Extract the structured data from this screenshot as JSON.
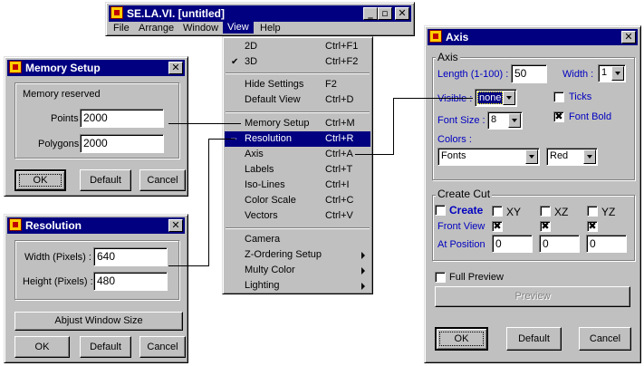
{
  "main_window": {
    "title": "SE.LA.VI. [untitled]",
    "controls": {
      "minimize": "_",
      "maximize": "▫",
      "close": "✕"
    },
    "menubar": [
      "File",
      "Arrange",
      "Window",
      "View",
      "Help"
    ]
  },
  "view_menu": {
    "items": [
      {
        "label": "2D",
        "shortcut": "Ctrl+F1"
      },
      {
        "label": "3D",
        "shortcut": "Ctrl+F2",
        "check": "✔"
      },
      {
        "label": "Hide Settings",
        "shortcut": "F2"
      },
      {
        "label": "Default View",
        "shortcut": "Ctrl+D"
      },
      {
        "label": "Memory Setup",
        "shortcut": "Ctrl+M"
      },
      {
        "label": "Resolution",
        "shortcut": "Ctrl+R",
        "check": "–"
      },
      {
        "label": "Axis",
        "shortcut": "Ctrl+A"
      },
      {
        "label": "Labels",
        "shortcut": "Ctrl+T"
      },
      {
        "label": "Iso-Lines",
        "shortcut": "Ctrl+I"
      },
      {
        "label": "Color Scale",
        "shortcut": "Ctrl+C"
      },
      {
        "label": "Vectors",
        "shortcut": "Ctrl+V"
      },
      {
        "label": "Camera"
      },
      {
        "label": "Z-Ordering Setup"
      },
      {
        "label": "Multy Color"
      },
      {
        "label": "Lighting"
      }
    ]
  },
  "memory_setup": {
    "title": "Memory Setup",
    "close": "✕",
    "group_label": "Memory reserved",
    "points_label": "Points",
    "points_value": "2000",
    "polygons_label": "Polygons",
    "polygons_value": "2000",
    "ok": "OK",
    "default": "Default",
    "cancel": "Cancel"
  },
  "resolution": {
    "title": "Resolution",
    "close": "✕",
    "width_label": "Width (Pixels) :",
    "width_value": "640",
    "height_label": "Height (Pixels) :",
    "height_value": "480",
    "adjust": "Abjust Window Size",
    "ok": "OK",
    "default": "Default",
    "cancel": "Cancel"
  },
  "axis": {
    "title": "Axis",
    "close": "✕",
    "group_axis": "Axis",
    "length_label": "Length (1-100) :",
    "length_value": "50",
    "width_label": "Width :",
    "width_value": "1",
    "visible_label": "Visible :",
    "visible_value": "none",
    "ticks_label": "Ticks",
    "font_size_label": "Font Size :",
    "font_size_value": "8",
    "font_bold_label": "Font Bold",
    "font_bold_check": "✖",
    "colors_label": "Colors :",
    "colors_item": "Fonts",
    "colors_value": "Red",
    "group_cut": "Create Cut",
    "create_label": "Create",
    "xy": "XY",
    "xz": "XZ",
    "yz": "YZ",
    "front_view_label": "Front View",
    "front_check": "✖",
    "at_position_label": "At Position",
    "pos_x": "0",
    "pos_y": "0",
    "pos_z": "0",
    "full_preview_label": "Full Preview",
    "preview": "Preview",
    "ok": "OK",
    "default": "Default",
    "cancel": "Cancel"
  }
}
